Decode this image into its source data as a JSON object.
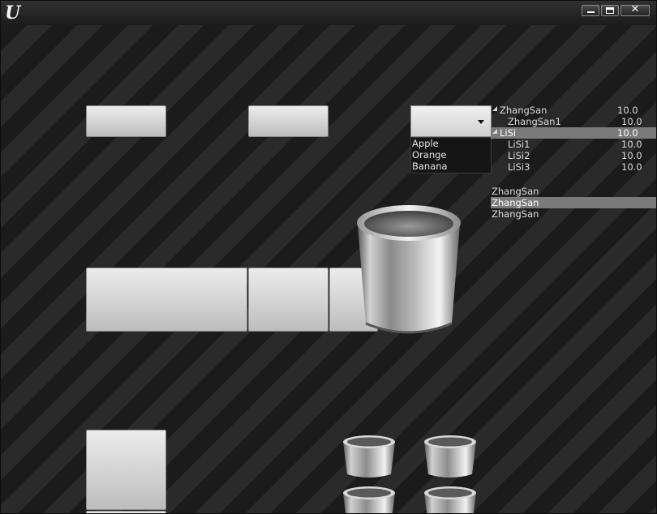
{
  "window": {
    "controls": {
      "minimize_icon": "minimize-icon",
      "maximize_icon": "maximize-icon",
      "close_icon": "close-icon",
      "close_glyph": "✕"
    }
  },
  "combo": {
    "selected": "",
    "options": [
      "Apple",
      "Orange",
      "Banana"
    ]
  },
  "tree": {
    "rows": [
      {
        "name": "ZhangSan",
        "value": "10.0"
      },
      {
        "name": "ZhangSan1",
        "value": "10.0"
      },
      {
        "name": "LiSi",
        "value": "10.0"
      },
      {
        "name": "LiSi1",
        "value": "10.0"
      },
      {
        "name": "LiSi2",
        "value": "10.0"
      },
      {
        "name": "LiSi3",
        "value": "10.0"
      }
    ]
  },
  "list": {
    "items": [
      "ZhangSan",
      "ZhangSan",
      "ZhangSan"
    ],
    "selected_index": 1
  },
  "colors": {
    "selection": "#7a7a7a",
    "button_top": "#ececec",
    "button_bottom": "#bdbdbd"
  }
}
